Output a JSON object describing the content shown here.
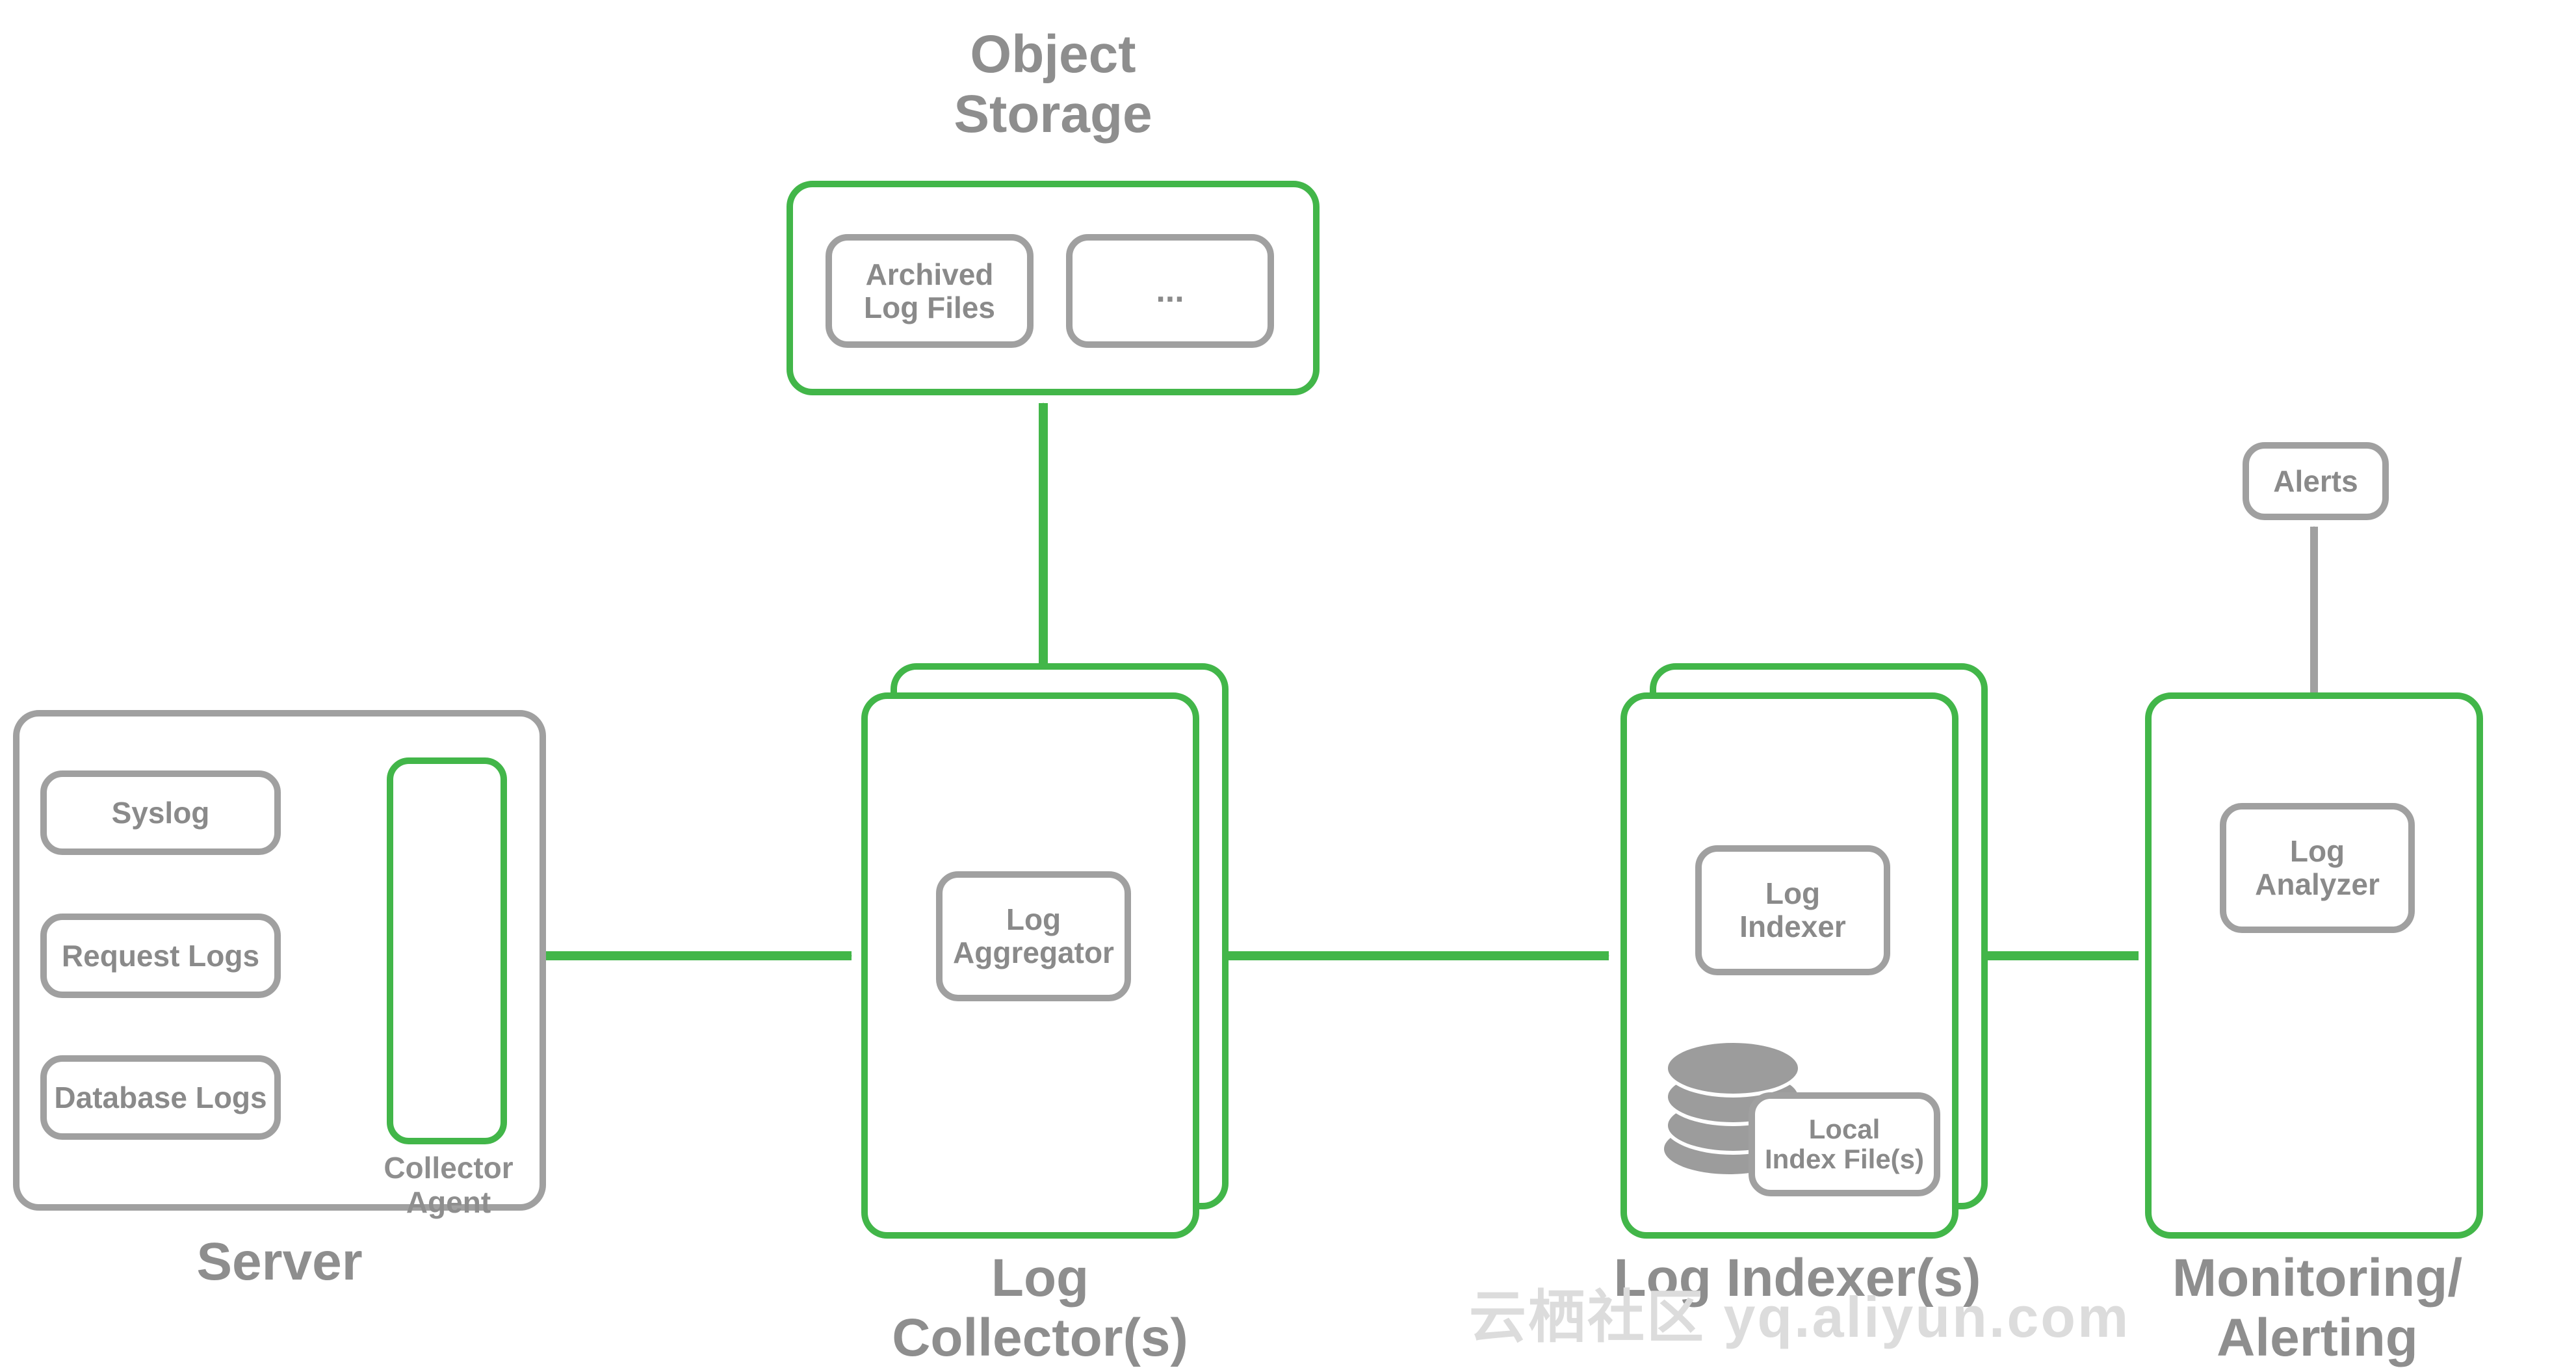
{
  "diagram": {
    "titles": {
      "object_storage": "Object\nStorage",
      "server": "Server",
      "log_collectors": "Log\nCollector(s)",
      "log_indexers": "Log Indexer(s)",
      "monitoring_alerting": "Monitoring/\nAlerting"
    },
    "server": {
      "sources": [
        "Syslog",
        "Request Logs",
        "Database Logs"
      ],
      "collector_agent_label": "Collector\nAgent"
    },
    "object_storage": {
      "items": [
        "Archived\nLog Files",
        "..."
      ]
    },
    "log_collector": {
      "component": "Log\nAggregator"
    },
    "log_indexer": {
      "component": "Log\nIndexer",
      "local_index_label": "Local\nIndex File(s)"
    },
    "monitoring": {
      "component": "Log\nAnalyzer",
      "alerts_label": "Alerts"
    },
    "colors": {
      "green": "#42b649",
      "gray": "#a0a0a0",
      "text_gray": "#8e8e8e",
      "disk_gray": "#9c9c9c"
    },
    "watermark": "云栖社区 yq.aliyun.com"
  }
}
